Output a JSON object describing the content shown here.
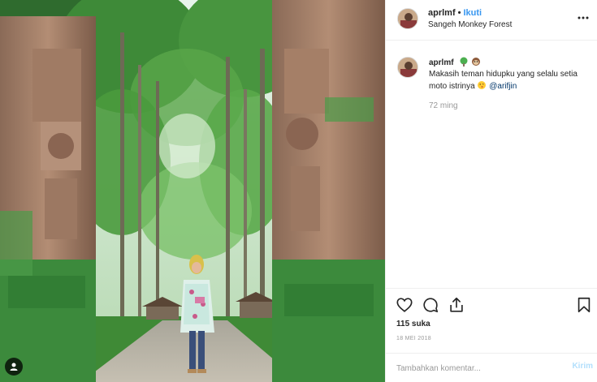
{
  "post": {
    "username": "aprlmf",
    "separator": "•",
    "follow_label": "Ikuti",
    "location": "Sangeh Monkey Forest",
    "caption": {
      "username": "aprlmf",
      "emoji_1": "tree-emoji",
      "emoji_2": "monkey-emoji",
      "text": "Makasih teman hidupku yang selalu setia moto istrinya",
      "emoji_3": "kiss-emoji",
      "mention": "@arifjin",
      "time_ago": "72 ming"
    },
    "likes": "115 suka",
    "date": "18 MEI 2018",
    "comment_placeholder": "Tambahkan komentar...",
    "post_button": "Kirim"
  },
  "icons": {
    "more": "more-options-icon",
    "like": "heart-icon",
    "comment": "comment-icon",
    "share": "share-icon",
    "save": "bookmark-icon",
    "tagged_user": "user-icon"
  },
  "colors": {
    "link": "#3897f0",
    "muted": "#999999",
    "mention": "#003569",
    "post_disabled": "#b2dffc"
  }
}
